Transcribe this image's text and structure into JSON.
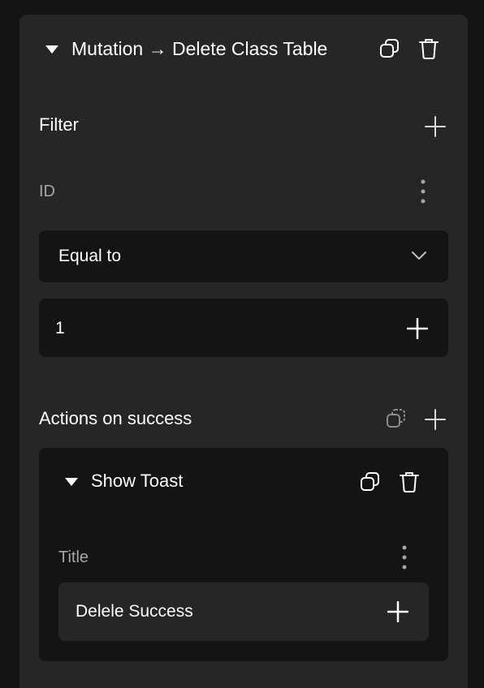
{
  "mutation_block": {
    "title": "Mutation → Delete Class Table",
    "actions": [
      "copy-icon",
      "trash-icon"
    ]
  },
  "filter": {
    "title": "Filter",
    "field_label": "ID",
    "operator": "Equal to",
    "value": "1"
  },
  "actions_on_success": {
    "title": "Actions on success",
    "action": {
      "name": "Show Toast",
      "field_label": "Title",
      "field_value": "Delele Success"
    }
  },
  "colors": {
    "page_bg": "#141414",
    "panel_bg": "#262626",
    "field_bg": "#141414",
    "text": "#ffffff",
    "muted_text": "#a6a6a6",
    "icon_muted": "#8c8c8c"
  }
}
